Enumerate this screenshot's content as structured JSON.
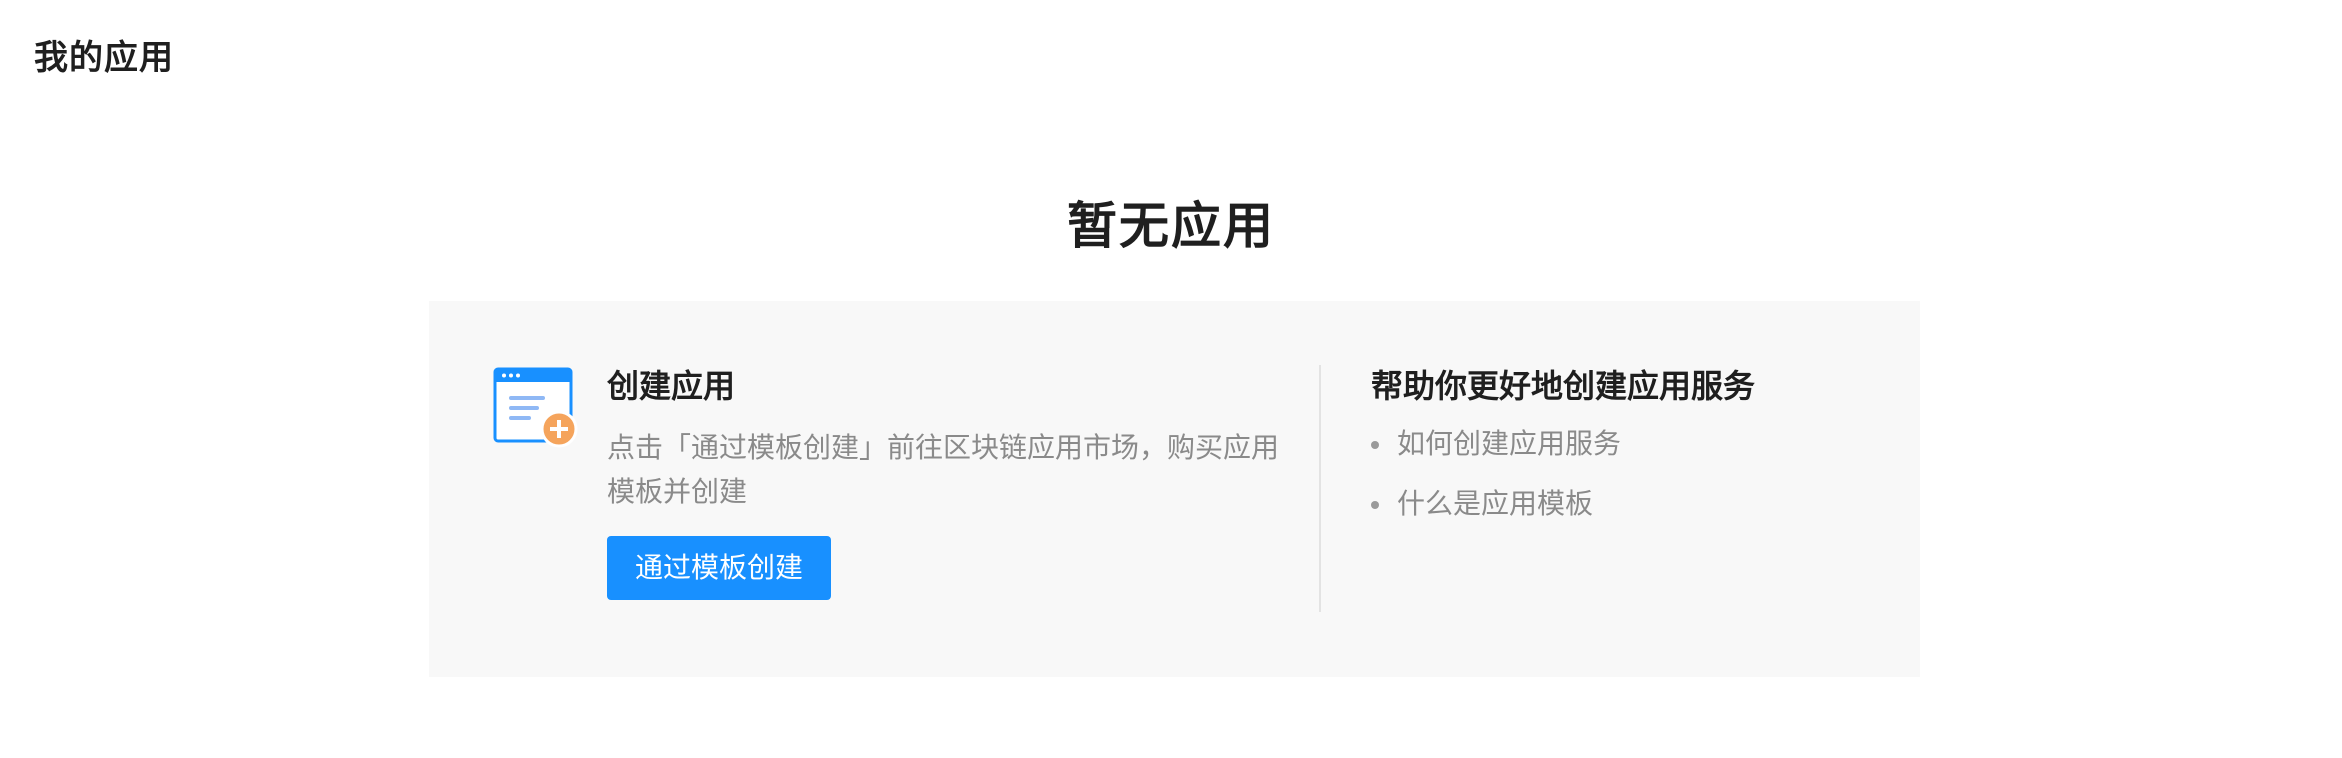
{
  "header": {
    "title": "我的应用"
  },
  "empty_state": {
    "title": "暂无应用"
  },
  "create_section": {
    "icon": "create-app-icon",
    "title": "创建应用",
    "description": "点击「通过模板创建」前往区块链应用市场，购买应用模板并创建",
    "button_label": "通过模板创建"
  },
  "help_section": {
    "title": "帮助你更好地创建应用服务",
    "links": [
      {
        "label": "如何创建应用服务"
      },
      {
        "label": "什么是应用模板"
      }
    ]
  },
  "colors": {
    "primary": "#1890ff",
    "icon_accent": "#f5a45c",
    "card_background": "#f8f8f8",
    "muted_text": "#8a8a8a"
  }
}
